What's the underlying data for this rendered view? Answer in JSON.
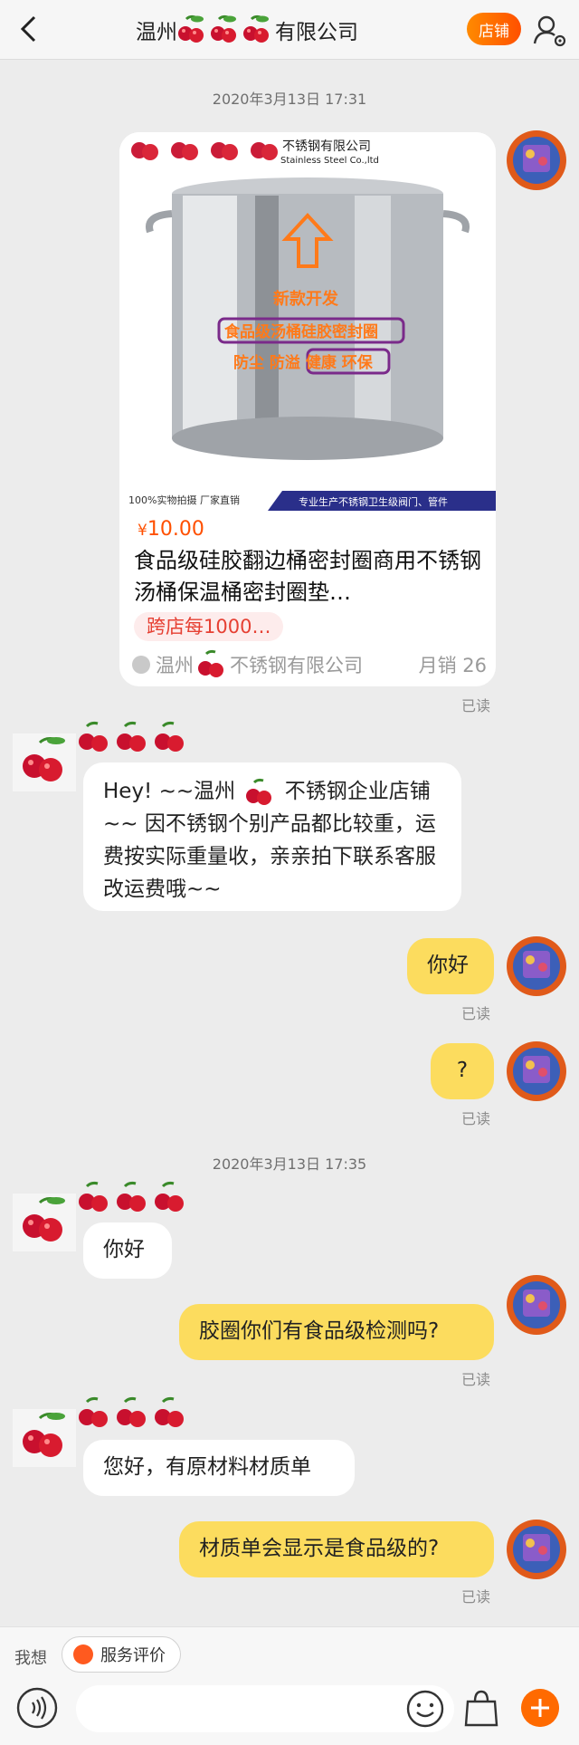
{
  "header": {
    "title_prefix": "温州",
    "title_suffix": "有限公司",
    "shop_button": "店铺"
  },
  "messages": {
    "time1": "2020年3月13日 17:31",
    "time2": "2020年3月13日 17:35",
    "product": {
      "image_brand": "不锈钢有限公司",
      "image_brand_en": "Stainless Steel Co.,ltd",
      "image_line1": "新款开发",
      "image_line2": "食品级汤桶硅胶密封圈",
      "image_line3": "防尘 防溢 健康 环保",
      "image_bar_left": "100%实物拍摄  厂家直销",
      "image_bar_right": "专业生产不锈钢卫生级阀门、管件",
      "currency": "¥",
      "price": "10.00",
      "title": "食品级硅胶翻边桶密封圈商用不锈钢汤桶保温桶密封圈垫…",
      "promo": "跨店每1000…",
      "shop_prefix": "温州",
      "shop_suffix": "不锈钢有限公司",
      "sales": "月销 26"
    },
    "read_label": "已读",
    "shop_greeting_a": "Hey! ~~温州",
    "shop_greeting_b": "不锈钢企业店铺~~ 因不锈钢个别产品都比较重，运费按实际重量收，亲亲拍下联系客服改运费哦~~",
    "me_hello": "你好",
    "me_question_mark": "?",
    "shop_hello": "你好",
    "me_q1": "胶圈你们有食品级检测吗?",
    "shop_a1": "您好，有原材料材质单",
    "me_q2": "材质单会显示是食品级的?"
  },
  "bottom": {
    "quick_label": "我想",
    "quick_chip": "服务评价",
    "input_placeholder": ""
  },
  "colors": {
    "accent": "#ff5000",
    "my_bubble": "#fcdc5e",
    "shop_bubble": "#ffffff",
    "price": "#ff5000"
  }
}
